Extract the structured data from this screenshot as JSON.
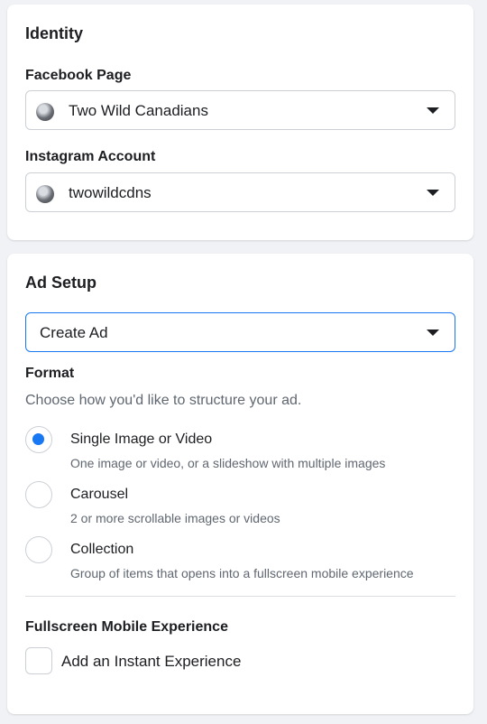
{
  "identity": {
    "title": "Identity",
    "facebook_page": {
      "label": "Facebook Page",
      "value": "Two Wild Canadians"
    },
    "instagram_account": {
      "label": "Instagram Account",
      "value": "twowildcdns"
    }
  },
  "ad_setup": {
    "title": "Ad Setup",
    "select_value": "Create Ad",
    "format": {
      "label": "Format",
      "helper": "Choose how you'd like to structure your ad.",
      "options": [
        {
          "title": "Single Image or Video",
          "description": "One image or video, or a slideshow with multiple images",
          "selected": true
        },
        {
          "title": "Carousel",
          "description": "2 or more scrollable images or videos",
          "selected": false
        },
        {
          "title": "Collection",
          "description": "Group of items that opens into a fullscreen mobile experience",
          "selected": false
        }
      ]
    },
    "fullscreen": {
      "label": "Fullscreen Mobile Experience",
      "checkbox_label": "Add an Instant Experience",
      "checked": false
    }
  },
  "colors": {
    "accent": "#1877f2",
    "border": "#ccd0d5",
    "muted_text": "#606770"
  },
  "icons": {
    "caret": "caret-down-icon",
    "avatar": "profile-avatar"
  }
}
